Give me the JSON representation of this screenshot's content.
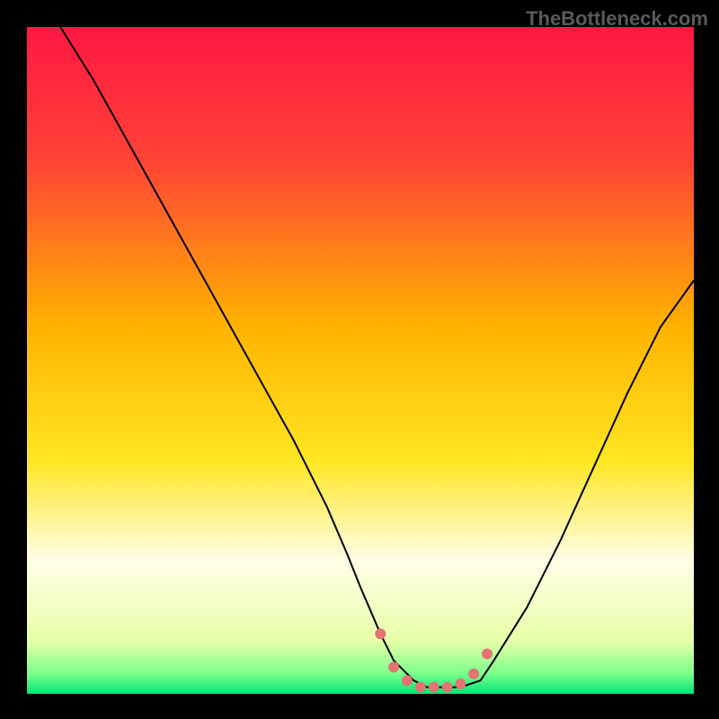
{
  "watermark": "TheBottleneck.com",
  "chart_data": {
    "type": "line",
    "title": "",
    "xlabel": "",
    "ylabel": "",
    "xlim": [
      0,
      100
    ],
    "ylim": [
      0,
      100
    ],
    "gradient_stops": [
      {
        "offset": 0,
        "color": "#ff1744"
      },
      {
        "offset": 20,
        "color": "#ff4336"
      },
      {
        "offset": 45,
        "color": "#ffb300"
      },
      {
        "offset": 65,
        "color": "#ffe622"
      },
      {
        "offset": 80,
        "color": "#fffde7"
      },
      {
        "offset": 92,
        "color": "#e7ffa8"
      },
      {
        "offset": 97,
        "color": "#7cff8b"
      },
      {
        "offset": 100,
        "color": "#00e676"
      }
    ],
    "series": [
      {
        "name": "bottleneck-curve",
        "stroke": "#000000",
        "stroke_width": 2,
        "x": [
          5,
          10,
          15,
          20,
          25,
          30,
          35,
          40,
          45,
          48,
          50,
          53,
          55,
          58,
          60,
          63,
          65,
          68,
          70,
          75,
          80,
          85,
          90,
          95,
          100
        ],
        "y": [
          100,
          92,
          83,
          74,
          65,
          56,
          47,
          38,
          28,
          21,
          16,
          9,
          5,
          2,
          1,
          1,
          1,
          2,
          5,
          13,
          23,
          34,
          45,
          55,
          62
        ]
      }
    ],
    "markers": {
      "name": "optimal-zone-dots",
      "color": "#e57373",
      "radius": 6,
      "x": [
        53,
        55,
        57,
        59,
        61,
        63,
        65,
        67,
        69
      ],
      "y": [
        9,
        4,
        2,
        1,
        1,
        1,
        1.5,
        3,
        6
      ]
    }
  }
}
